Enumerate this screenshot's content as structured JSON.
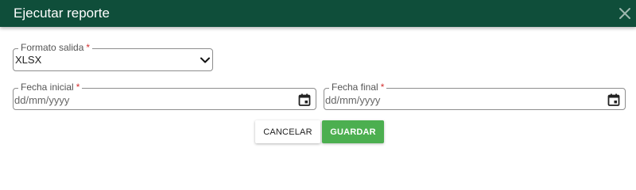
{
  "dialog": {
    "title": "Ejecutar reporte",
    "close_icon": "close-icon"
  },
  "form": {
    "output_format": {
      "label": "Formato salida",
      "required_mark": "*",
      "value": "XLSX"
    },
    "start_date": {
      "label": "Fecha inicial",
      "required_mark": "*",
      "placeholder": "dd/mm/yyyy",
      "icon": "calendar-icon"
    },
    "end_date": {
      "label": "Fecha final",
      "required_mark": "*",
      "placeholder": "dd/mm/yyyy",
      "icon": "calendar-icon"
    }
  },
  "actions": {
    "cancel_label": "CANCELAR",
    "save_label": "GUARDAR"
  },
  "colors": {
    "header": "#0f4e3a",
    "primary_button": "#4caf50",
    "required": "#d32f2f"
  }
}
